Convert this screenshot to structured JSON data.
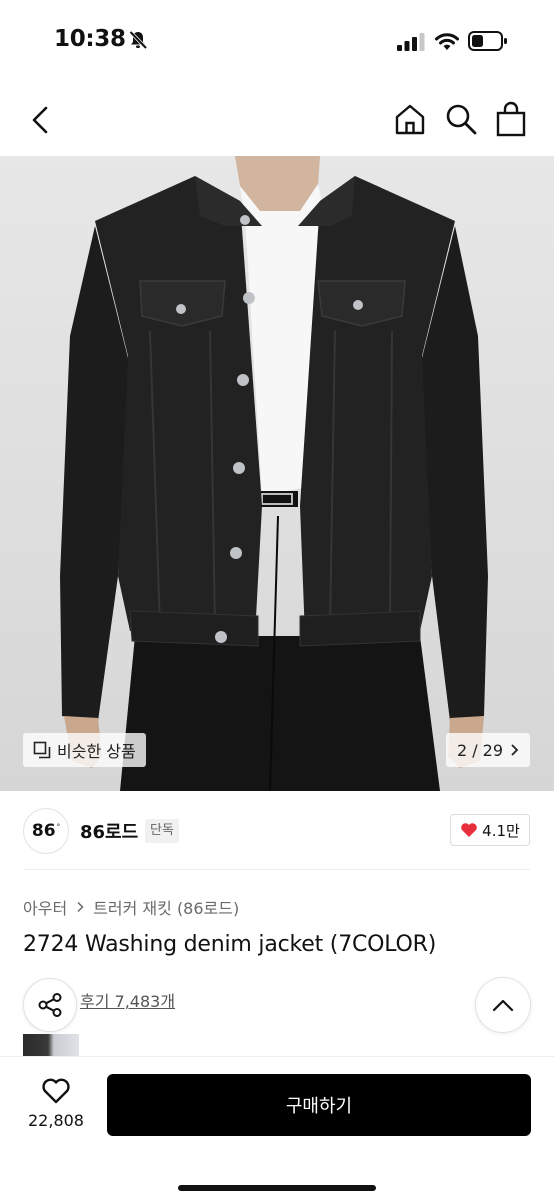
{
  "status_bar": {
    "time": "10:38"
  },
  "product_image": {
    "similar_label": "비슷한 상품",
    "page_indicator": "2 / 29"
  },
  "brand": {
    "logo_text": "86",
    "logo_mark": "°",
    "name": "86로드",
    "tag": "단독",
    "likes": "4.1만"
  },
  "breadcrumb": {
    "category": "아우터",
    "subcategory": "트러커 재킷 (86로드)"
  },
  "product": {
    "title": "2724 Washing denim jacket (7COLOR)",
    "review_link": "후기 7,483개"
  },
  "bottom_bar": {
    "wish_count": "22,808",
    "buy_label": "구매하기"
  },
  "colors": {
    "accent": "#e8303c",
    "buy_button": "#000000"
  }
}
